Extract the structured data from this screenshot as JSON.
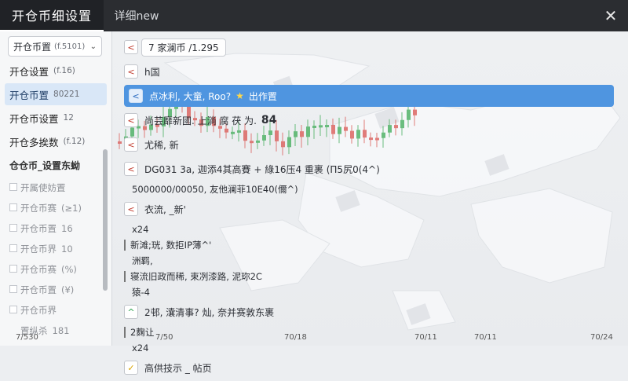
{
  "titlebar": {
    "active_tab": "开仓币细设置",
    "tab2": "详细new",
    "close_icon": "close-icon"
  },
  "sidebar": {
    "dropdown": {
      "label": "开仓币置",
      "sub": "(f.5101)"
    },
    "items": [
      {
        "label": "开仓设置",
        "sub": "(f.16)"
      },
      {
        "label": "开仓币置",
        "sub": "80221",
        "active": true
      },
      {
        "label": "开仓币设置",
        "sub": "12"
      },
      {
        "label": "开仓多挨数",
        "sub": "(f.12)"
      }
    ],
    "group_label": "仓仓币_设置东蚴",
    "sub_items": [
      {
        "label": "开属使妨置",
        "sub": ""
      },
      {
        "label": "开仓币赛",
        "sub": "(≥1)"
      },
      {
        "label": "开仓币置",
        "sub": "16"
      },
      {
        "label": "开仓币界",
        "sub": "10"
      },
      {
        "label": "开仓币赛",
        "sub": "(%)"
      },
      {
        "label": "开仓币置",
        "sub": "(¥)"
      },
      {
        "label": "开仓币界",
        "sub": ""
      },
      {
        "label": "置纵杀",
        "sub": "181"
      }
    ]
  },
  "rows": [
    {
      "icon": "<",
      "text": "7 家澜币 /1.295",
      "boxed": true
    },
    {
      "icon": "<",
      "text": "h国"
    },
    {
      "icon": "<",
      "text": "点冰利, 大童, Roo?",
      "highlight": true,
      "extra": "出作置"
    },
    {
      "icon": "<",
      "text": "尚芸靡新國. 上淌 腐 茯 为.",
      "big": "84"
    },
    {
      "icon": "<",
      "text": "尤稀, 新"
    },
    {
      "icon": "<",
      "text": "DG031 3a, 迦添4其高賽 + 綠16压4 重裹 (Π5尻0(4^)"
    },
    {
      "icon": "",
      "text": "5000000/00050, 友他澜菲10E40(儞^)",
      "plain": true
    },
    {
      "icon": "<",
      "text": "衣流, _新'"
    },
    {
      "icon": "",
      "text": "x24",
      "plain": true
    },
    {
      "icon": "",
      "text": "新滩;珖, 数拒IP薄^'",
      "plain": true,
      "bar": true
    },
    {
      "icon": "",
      "text": "洲羁,",
      "plain": true
    },
    {
      "icon": "",
      "text": "寝流旧政而稀, 束冽漆路, 泥珎2C",
      "plain": true,
      "bar": true
    },
    {
      "icon": "",
      "text": "猿-4",
      "plain": true
    },
    {
      "icon": "^",
      "text": "2邨, 灢清事? 灿, 奈并赛敦东裹",
      "green": true
    },
    {
      "icon": "",
      "text": "2麴让",
      "plain": true,
      "bar": true
    },
    {
      "icon": "",
      "text": "x24",
      "plain": true
    },
    {
      "icon": "✓",
      "text": "高供技示 _ 帖页",
      "yellow": true
    }
  ],
  "xaxis": {
    "left_label": "7/530",
    "ticks": [
      "7/50",
      "70/18",
      "70/11",
      "70/11",
      "70/24"
    ]
  }
}
